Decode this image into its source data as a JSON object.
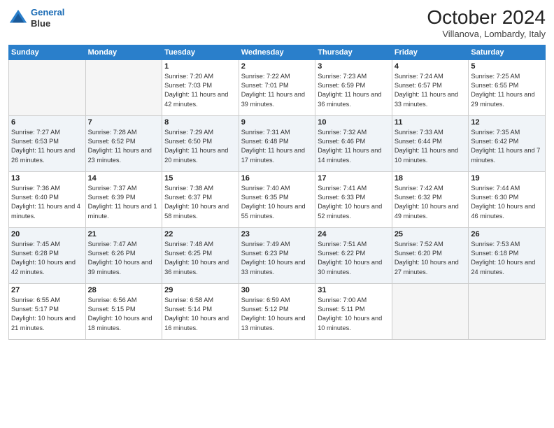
{
  "header": {
    "logo_line1": "General",
    "logo_line2": "Blue",
    "month": "October 2024",
    "location": "Villanova, Lombardy, Italy"
  },
  "weekdays": [
    "Sunday",
    "Monday",
    "Tuesday",
    "Wednesday",
    "Thursday",
    "Friday",
    "Saturday"
  ],
  "weeks": [
    [
      {
        "day": "",
        "empty": true
      },
      {
        "day": "",
        "empty": true
      },
      {
        "day": "1",
        "sunrise": "Sunrise: 7:20 AM",
        "sunset": "Sunset: 7:03 PM",
        "daylight": "Daylight: 11 hours and 42 minutes."
      },
      {
        "day": "2",
        "sunrise": "Sunrise: 7:22 AM",
        "sunset": "Sunset: 7:01 PM",
        "daylight": "Daylight: 11 hours and 39 minutes."
      },
      {
        "day": "3",
        "sunrise": "Sunrise: 7:23 AM",
        "sunset": "Sunset: 6:59 PM",
        "daylight": "Daylight: 11 hours and 36 minutes."
      },
      {
        "day": "4",
        "sunrise": "Sunrise: 7:24 AM",
        "sunset": "Sunset: 6:57 PM",
        "daylight": "Daylight: 11 hours and 33 minutes."
      },
      {
        "day": "5",
        "sunrise": "Sunrise: 7:25 AM",
        "sunset": "Sunset: 6:55 PM",
        "daylight": "Daylight: 11 hours and 29 minutes."
      }
    ],
    [
      {
        "day": "6",
        "sunrise": "Sunrise: 7:27 AM",
        "sunset": "Sunset: 6:53 PM",
        "daylight": "Daylight: 11 hours and 26 minutes."
      },
      {
        "day": "7",
        "sunrise": "Sunrise: 7:28 AM",
        "sunset": "Sunset: 6:52 PM",
        "daylight": "Daylight: 11 hours and 23 minutes."
      },
      {
        "day": "8",
        "sunrise": "Sunrise: 7:29 AM",
        "sunset": "Sunset: 6:50 PM",
        "daylight": "Daylight: 11 hours and 20 minutes."
      },
      {
        "day": "9",
        "sunrise": "Sunrise: 7:31 AM",
        "sunset": "Sunset: 6:48 PM",
        "daylight": "Daylight: 11 hours and 17 minutes."
      },
      {
        "day": "10",
        "sunrise": "Sunrise: 7:32 AM",
        "sunset": "Sunset: 6:46 PM",
        "daylight": "Daylight: 11 hours and 14 minutes."
      },
      {
        "day": "11",
        "sunrise": "Sunrise: 7:33 AM",
        "sunset": "Sunset: 6:44 PM",
        "daylight": "Daylight: 11 hours and 10 minutes."
      },
      {
        "day": "12",
        "sunrise": "Sunrise: 7:35 AM",
        "sunset": "Sunset: 6:42 PM",
        "daylight": "Daylight: 11 hours and 7 minutes."
      }
    ],
    [
      {
        "day": "13",
        "sunrise": "Sunrise: 7:36 AM",
        "sunset": "Sunset: 6:40 PM",
        "daylight": "Daylight: 11 hours and 4 minutes."
      },
      {
        "day": "14",
        "sunrise": "Sunrise: 7:37 AM",
        "sunset": "Sunset: 6:39 PM",
        "daylight": "Daylight: 11 hours and 1 minute."
      },
      {
        "day": "15",
        "sunrise": "Sunrise: 7:38 AM",
        "sunset": "Sunset: 6:37 PM",
        "daylight": "Daylight: 10 hours and 58 minutes."
      },
      {
        "day": "16",
        "sunrise": "Sunrise: 7:40 AM",
        "sunset": "Sunset: 6:35 PM",
        "daylight": "Daylight: 10 hours and 55 minutes."
      },
      {
        "day": "17",
        "sunrise": "Sunrise: 7:41 AM",
        "sunset": "Sunset: 6:33 PM",
        "daylight": "Daylight: 10 hours and 52 minutes."
      },
      {
        "day": "18",
        "sunrise": "Sunrise: 7:42 AM",
        "sunset": "Sunset: 6:32 PM",
        "daylight": "Daylight: 10 hours and 49 minutes."
      },
      {
        "day": "19",
        "sunrise": "Sunrise: 7:44 AM",
        "sunset": "Sunset: 6:30 PM",
        "daylight": "Daylight: 10 hours and 46 minutes."
      }
    ],
    [
      {
        "day": "20",
        "sunrise": "Sunrise: 7:45 AM",
        "sunset": "Sunset: 6:28 PM",
        "daylight": "Daylight: 10 hours and 42 minutes."
      },
      {
        "day": "21",
        "sunrise": "Sunrise: 7:47 AM",
        "sunset": "Sunset: 6:26 PM",
        "daylight": "Daylight: 10 hours and 39 minutes."
      },
      {
        "day": "22",
        "sunrise": "Sunrise: 7:48 AM",
        "sunset": "Sunset: 6:25 PM",
        "daylight": "Daylight: 10 hours and 36 minutes."
      },
      {
        "day": "23",
        "sunrise": "Sunrise: 7:49 AM",
        "sunset": "Sunset: 6:23 PM",
        "daylight": "Daylight: 10 hours and 33 minutes."
      },
      {
        "day": "24",
        "sunrise": "Sunrise: 7:51 AM",
        "sunset": "Sunset: 6:22 PM",
        "daylight": "Daylight: 10 hours and 30 minutes."
      },
      {
        "day": "25",
        "sunrise": "Sunrise: 7:52 AM",
        "sunset": "Sunset: 6:20 PM",
        "daylight": "Daylight: 10 hours and 27 minutes."
      },
      {
        "day": "26",
        "sunrise": "Sunrise: 7:53 AM",
        "sunset": "Sunset: 6:18 PM",
        "daylight": "Daylight: 10 hours and 24 minutes."
      }
    ],
    [
      {
        "day": "27",
        "sunrise": "Sunrise: 6:55 AM",
        "sunset": "Sunset: 5:17 PM",
        "daylight": "Daylight: 10 hours and 21 minutes."
      },
      {
        "day": "28",
        "sunrise": "Sunrise: 6:56 AM",
        "sunset": "Sunset: 5:15 PM",
        "daylight": "Daylight: 10 hours and 18 minutes."
      },
      {
        "day": "29",
        "sunrise": "Sunrise: 6:58 AM",
        "sunset": "Sunset: 5:14 PM",
        "daylight": "Daylight: 10 hours and 16 minutes."
      },
      {
        "day": "30",
        "sunrise": "Sunrise: 6:59 AM",
        "sunset": "Sunset: 5:12 PM",
        "daylight": "Daylight: 10 hours and 13 minutes."
      },
      {
        "day": "31",
        "sunrise": "Sunrise: 7:00 AM",
        "sunset": "Sunset: 5:11 PM",
        "daylight": "Daylight: 10 hours and 10 minutes."
      },
      {
        "day": "",
        "empty": true
      },
      {
        "day": "",
        "empty": true
      }
    ]
  ]
}
